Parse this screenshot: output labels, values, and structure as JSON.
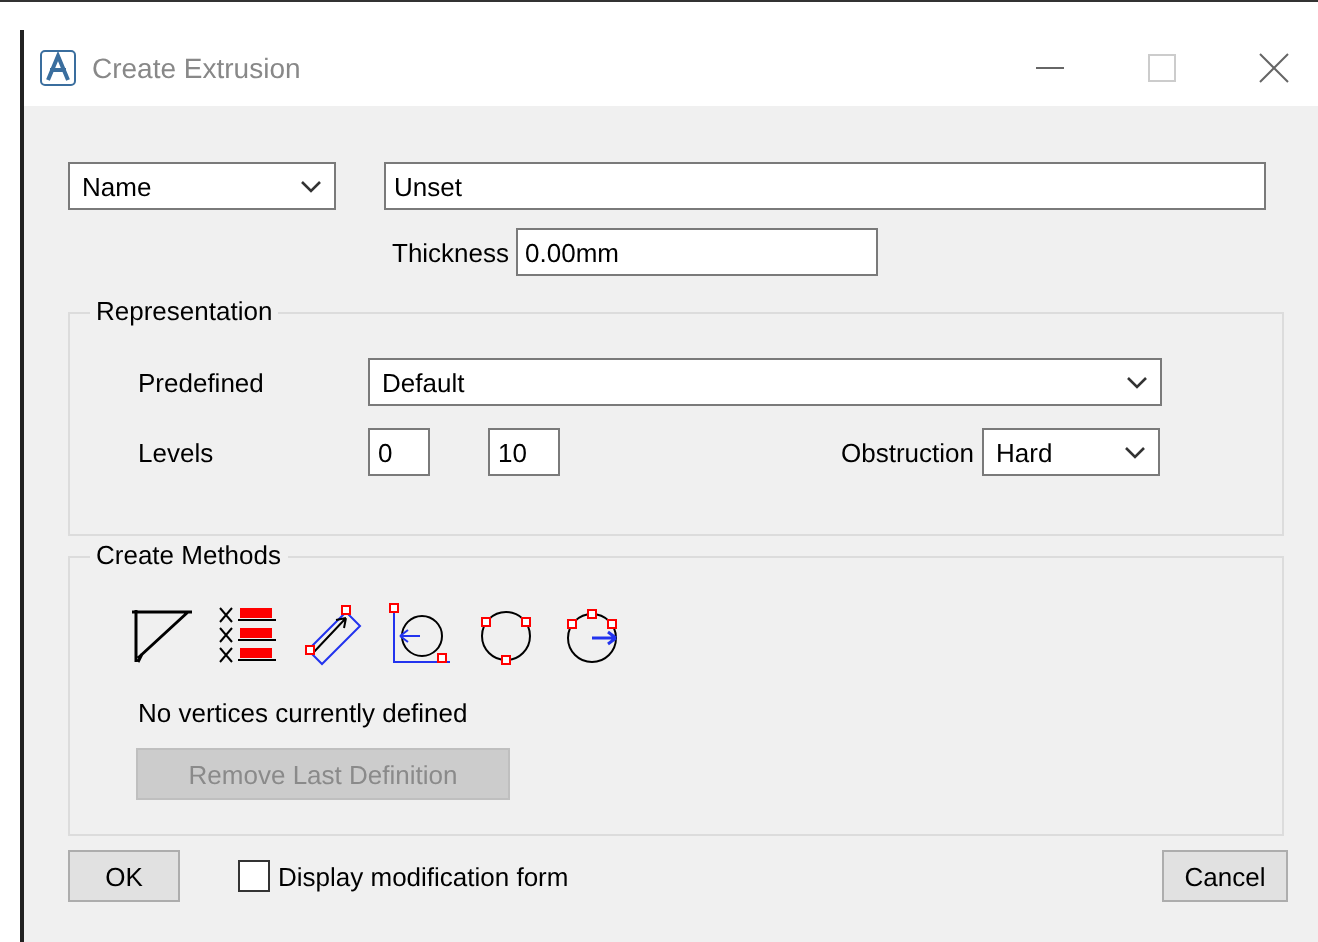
{
  "window": {
    "title": "Create Extrusion"
  },
  "name_select": {
    "value": "Name"
  },
  "name_field": {
    "value": "Unset"
  },
  "thickness": {
    "label": "Thickness",
    "value": "0.00mm"
  },
  "representation": {
    "title": "Representation",
    "predefined_label": "Predefined",
    "predefined_value": "Default",
    "levels_label": "Levels",
    "level_from": "0",
    "level_to": "10",
    "obstruction_label": "Obstruction",
    "obstruction_value": "Hard"
  },
  "create_methods": {
    "title": "Create Methods",
    "tools": [
      {
        "kind": "polyline"
      },
      {
        "kind": "coordinates"
      },
      {
        "kind": "rectangle"
      },
      {
        "kind": "circle-center"
      },
      {
        "kind": "circle-three-point"
      },
      {
        "kind": "circle-radius"
      }
    ],
    "status": "No vertices currently defined",
    "remove_button": {
      "label": "Remove Last Definition",
      "disabled": true
    }
  },
  "footer": {
    "ok": "OK",
    "checkbox": {
      "label": "Display modification form",
      "checked": false
    },
    "cancel": "Cancel"
  }
}
